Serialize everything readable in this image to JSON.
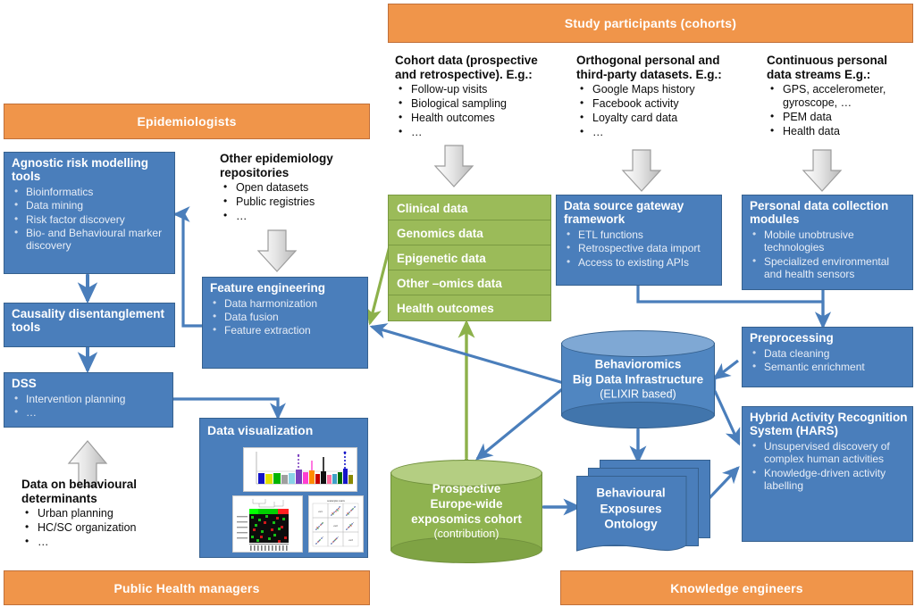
{
  "actors": {
    "study_participants": "Study participants (cohorts)",
    "epidemiologists": "Epidemiologists",
    "public_health_managers": "Public Health managers",
    "knowledge_engineers": "Knowledge engineers"
  },
  "inputs": {
    "cohort_data": {
      "heading": "Cohort data (prospective and retrospective). E.g.:",
      "items": [
        "Follow-up visits",
        "Biological sampling",
        "Health outcomes",
        "…"
      ]
    },
    "orthogonal_data": {
      "heading": "Orthogonal personal and third-party datasets. E.g.:",
      "items": [
        "Google Maps history",
        "Facebook activity",
        "Loyalty card data",
        "…"
      ]
    },
    "continuous_streams": {
      "heading": "Continuous personal data streams E.g.:",
      "items": [
        "GPS, accelerometer, gyroscope,  …",
        "PEM data",
        "Health data"
      ]
    },
    "other_repositories": {
      "heading": "Other epidemiology repositories",
      "items": [
        "Open datasets",
        "Public registries",
        "…"
      ]
    },
    "behavioural_determinants": {
      "heading": "Data on behavioural determinants",
      "items": [
        "Urban planning",
        "HC/SC organization",
        "…"
      ]
    }
  },
  "modules": {
    "agnostic_risk": {
      "title": "Agnostic risk modelling tools",
      "items": [
        "Bioinformatics",
        "Data mining",
        "Risk factor discovery",
        "Bio- and Behavioural marker  discovery"
      ]
    },
    "causality": {
      "title": "Causality disentanglement tools",
      "items": []
    },
    "dss": {
      "title": "DSS",
      "items": [
        "Intervention planning",
        "…"
      ]
    },
    "feature_engineering": {
      "title": "Feature engineering",
      "items": [
        "Data harmonization",
        "Data fusion",
        "Feature extraction"
      ]
    },
    "data_visualization": {
      "title": "Data visualization"
    },
    "data_source_gateway": {
      "title": "Data source gateway framework",
      "items": [
        "ETL functions",
        "Retrospective  data import",
        "Access  to existing APIs"
      ]
    },
    "personal_data_collection": {
      "title": "Personal data collection modules",
      "items": [
        "Mobile unobtrusive technologies",
        "Specialized environmental and health sensors"
      ]
    },
    "preprocessing": {
      "title": "Preprocessing",
      "items": [
        "Data cleaning",
        "Semantic enrichment"
      ]
    },
    "hars": {
      "title": "Hybrid Activity Recognition System (HARS)",
      "items": [
        "Unsupervised discovery of complex human activities",
        "Knowledge-driven activity labelling"
      ]
    }
  },
  "data_types": [
    "Clinical data",
    "Genomics data",
    "Epigenetic data",
    "Other –omics data",
    "Health outcomes"
  ],
  "stores": {
    "big_data": {
      "line1": "Behavioromics",
      "line2": "Big Data Infrastructure",
      "line3": "(ELIXIR based)"
    },
    "cohort_store": {
      "line1": "Prospective",
      "line2": "Europe-wide",
      "line3": "exposomics cohort",
      "line4": "(contribution)"
    },
    "ontology": {
      "line1": "Behavioural",
      "line2": "Exposures",
      "line3": "Ontology"
    }
  },
  "colors": {
    "orange": "#F0954A",
    "orange_border": "#C0703A",
    "blue": "#4A7EBB",
    "blue_border": "#36618F",
    "green": "#9BBB59",
    "green_border": "#7A9A41",
    "gray_arrow": "#D9D9D9",
    "gray_arrow_border": "#9C9C9C"
  }
}
